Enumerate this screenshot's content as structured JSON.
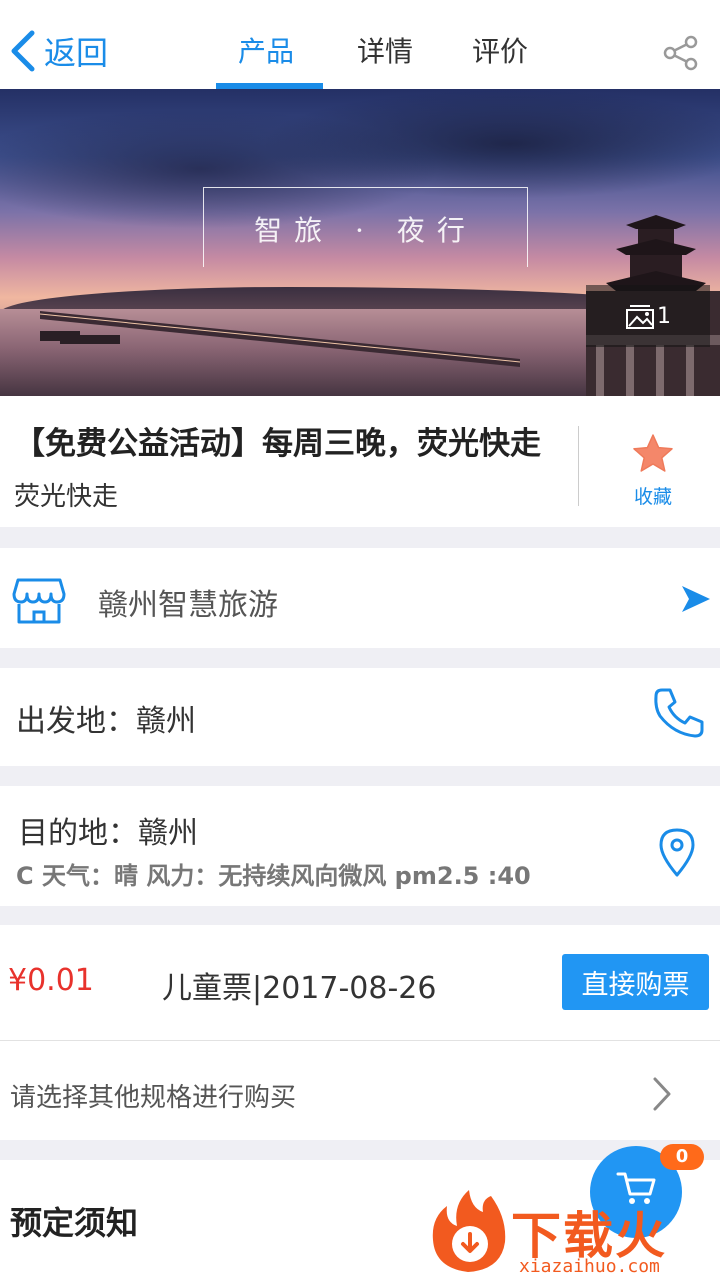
{
  "nav": {
    "back_label": "返回",
    "tabs": [
      {
        "label": "产品",
        "active": true
      },
      {
        "label": "详情",
        "active": false
      },
      {
        "label": "评价",
        "active": false
      }
    ]
  },
  "hero": {
    "overlay_title": "智旅 · 夜行",
    "photo_count": "1"
  },
  "product": {
    "title": "【免费公益活动】每周三晚，荧光快走",
    "subtitle": "荧光快走",
    "favorite_label": "收藏"
  },
  "shop": {
    "name": "赣州智慧旅游"
  },
  "departure": {
    "text": "出发地：赣州"
  },
  "destination": {
    "text": "目的地：赣州",
    "weather": "C 天气：晴 风力：无持续风向微风  pm2.5 :40"
  },
  "ticket": {
    "price": "¥0.01",
    "description": "儿童票|2017-08-26",
    "buy_label": "直接购票",
    "other_spec": "请选择其他规格进行购买"
  },
  "notice": {
    "title": "预定须知"
  },
  "cart": {
    "badge": "0"
  },
  "watermark": {
    "brand": "下载火",
    "domain": "xiazaihuo.com"
  },
  "colors": {
    "accent": "#1a8ce8",
    "price": "#e8322c",
    "star": "#f4876a",
    "badge": "#ff6a1a"
  }
}
